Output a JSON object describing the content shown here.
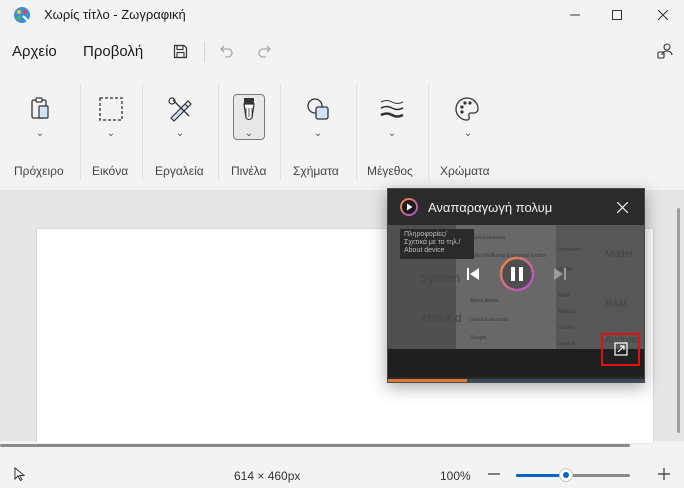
{
  "window": {
    "title": "Χωρίς τίτλο - Ζωγραφική",
    "minimize_icon": "minimize-icon",
    "maximize_icon": "maximize-icon",
    "close_icon": "close-icon"
  },
  "menubar": {
    "file_label": "Αρχείο",
    "view_label": "Προβολή",
    "save_icon": "save-icon",
    "undo_icon": "undo-icon",
    "redo_icon": "redo-icon",
    "account_icon": "account-icon"
  },
  "ribbon": {
    "groups": [
      {
        "label": "Πρόχειρο",
        "icon": "clipboard-icon"
      },
      {
        "label": "Εικόνα",
        "icon": "selection-icon"
      },
      {
        "label": "Εργαλεία",
        "icon": "tools-icon"
      },
      {
        "label": "Πινέλα",
        "icon": "brush-icon"
      },
      {
        "label": "Σχήματα",
        "icon": "shapes-icon"
      },
      {
        "label": "Μέγεθος",
        "icon": "size-icon"
      },
      {
        "label": "Χρώματα",
        "icon": "palette-icon"
      }
    ]
  },
  "status": {
    "canvas_size": "614 × 460px",
    "zoom": "100%",
    "zoom_level_fraction": 0.44,
    "pointer_icon": "pointer-icon",
    "zoom_out_icon": "minus-icon",
    "zoom_in_icon": "plus-icon"
  },
  "pip": {
    "title": "Αναπαραγωγή πολυμ",
    "progress_fraction": 0.31,
    "tooltip_lines": [
      "Πληροφορίες/",
      "Σχετικά με το τηλ./",
      "About device"
    ],
    "video_texts": {
      "system": "System",
      "about": "About d",
      "model": "Model",
      "ram": "RAM",
      "android": "Android",
      "general": "General features",
      "digital": "Digital Wellbeing & parental control",
      "about_device": "About device",
      "users": "Users & accounts",
      "google": "Google",
      "processor": "Processor",
      "model_small": "Model",
      "ram_small": "RAM",
      "android_small": "Android",
      "version": "Version",
      "legal": "Legal in"
    }
  },
  "colors": {
    "accent": "#0067c0",
    "pip_progress": "#e07a2e",
    "highlight": "#e01010"
  }
}
